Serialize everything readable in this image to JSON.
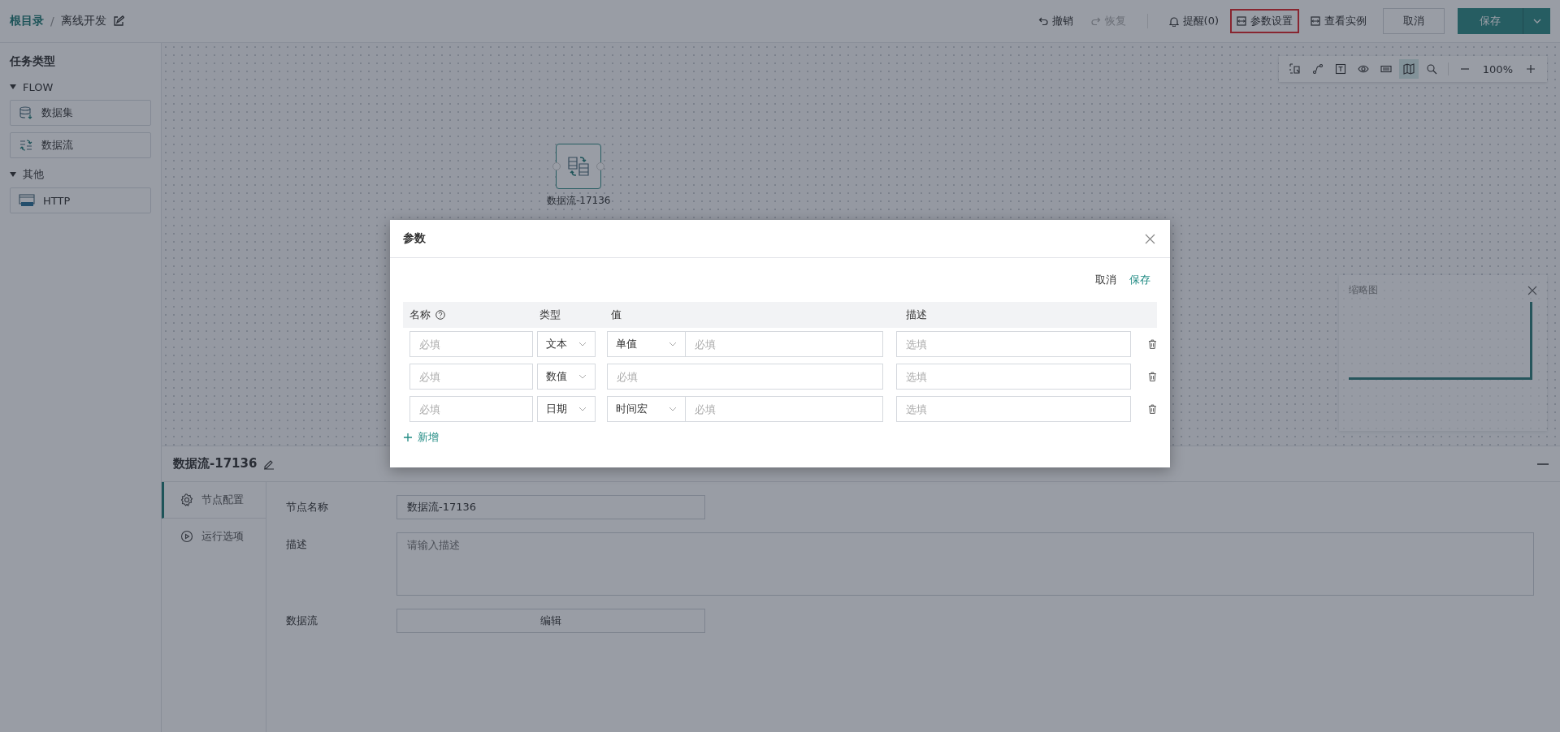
{
  "breadcrumb": {
    "root": "根目录",
    "separator": "/",
    "current": "离线开发"
  },
  "header_actions": [
    {
      "kind": "undo",
      "label": "撤销",
      "disabled": false,
      "highlighted": false
    },
    {
      "kind": "redo",
      "label": "恢复",
      "disabled": true,
      "highlighted": false
    },
    {
      "kind": "bell",
      "label": "提醒(0)",
      "disabled": false,
      "highlighted": false
    },
    {
      "kind": "params",
      "label": "参数设置",
      "disabled": false,
      "highlighted": true
    },
    {
      "kind": "params",
      "label": "查看实例",
      "disabled": false,
      "highlighted": false
    }
  ],
  "cancel_button": "取消",
  "save_button": "保存",
  "sidebar": {
    "title": "任务类型",
    "groups": [
      {
        "name": "FLOW",
        "expanded": true,
        "items": [
          {
            "kind": "dataset",
            "label": "数据集"
          },
          {
            "kind": "dataflow",
            "label": "数据流"
          }
        ]
      },
      {
        "name": "其他",
        "expanded": true,
        "items": [
          {
            "kind": "http",
            "label": "HTTP"
          }
        ]
      }
    ]
  },
  "canvas_tools": [
    {
      "kind": "select",
      "selected": false
    },
    {
      "kind": "link",
      "selected": false
    },
    {
      "kind": "text",
      "selected": false
    },
    {
      "kind": "eye",
      "selected": false
    },
    {
      "kind": "keyboard",
      "selected": false
    },
    {
      "kind": "map",
      "selected": true
    },
    {
      "kind": "search",
      "selected": false
    }
  ],
  "zoom": "100%",
  "node": {
    "label": "数据流-17136"
  },
  "minimap": {
    "title": "缩略图"
  },
  "dialog": {
    "title": "参数",
    "cancel": "取消",
    "save": "保存",
    "add": "新增",
    "columns": [
      {
        "kind": "help",
        "label": "名称"
      },
      {
        "kind": "plain",
        "label": "类型"
      },
      {
        "kind": "plain",
        "label": "值"
      },
      {
        "kind": "plain",
        "label": "描述"
      }
    ],
    "rows": [
      {
        "name_placeholder": "必填",
        "type": "文本",
        "value": {
          "mode": "单值",
          "placeholder": "必填"
        },
        "description_placeholder": "选填"
      },
      {
        "name_placeholder": "必填",
        "type": "数值",
        "value": {
          "placeholder": "必填"
        },
        "description_placeholder": "选填"
      },
      {
        "name_placeholder": "必填",
        "type": "日期",
        "value": {
          "mode": "时间宏",
          "placeholder": "必填"
        },
        "description_placeholder": "选填"
      }
    ]
  },
  "panel": {
    "title": "数据流-17136",
    "tabs": [
      {
        "kind": "gear",
        "label": "节点配置",
        "selected": true
      },
      {
        "kind": "play",
        "label": "运行选项",
        "selected": false
      }
    ],
    "fields": [
      {
        "kind": "input",
        "label": "节点名称",
        "value": "数据流-17136"
      },
      {
        "kind": "textarea",
        "label": "描述",
        "placeholder": "请输入描述"
      },
      {
        "kind": "button",
        "label": "数据流",
        "button": "编辑"
      }
    ]
  }
}
